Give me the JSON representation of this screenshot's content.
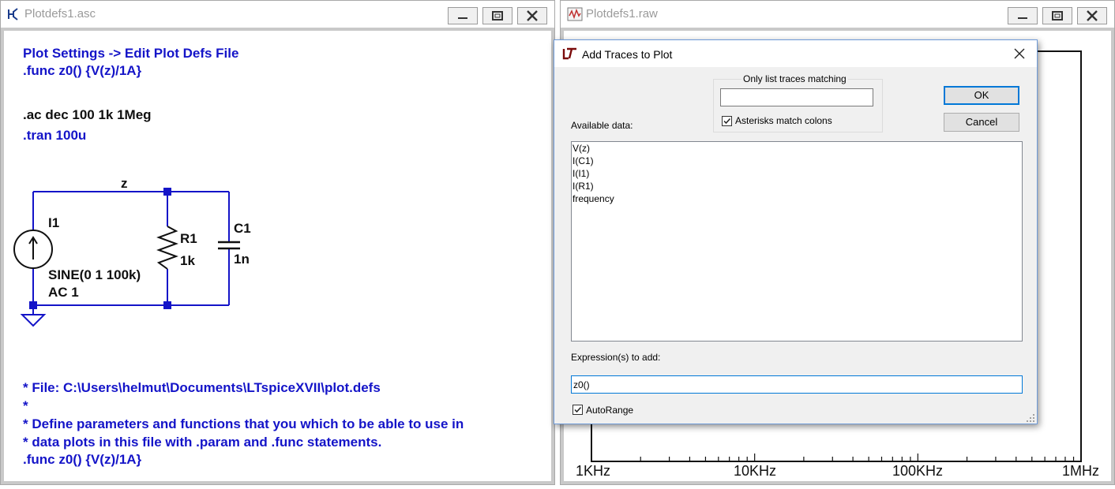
{
  "schematic_window": {
    "title": "Plotdefs1.asc",
    "directives": {
      "line1": "Plot Settings -> Edit Plot Defs File",
      "line2": ".func z0() {V(z)/1A}",
      "ac": ".ac dec 100 1k 1Meg",
      "tran": ".tran 100u"
    },
    "circuit": {
      "net_label": "z",
      "source_name": "I1",
      "source_value1": "SINE(0 1 100k)",
      "source_value2": "AC 1",
      "resistor_name": "R1",
      "resistor_value": "1k",
      "capacitor_name": "C1",
      "capacitor_value": "1n"
    },
    "comment_lines": [
      "* File: C:\\Users\\helmut\\Documents\\LTspiceXVII\\plot.defs",
      "*",
      "* Define parameters and functions that you which to be able to use in",
      "* data plots in this file with .param and .func statements.",
      ".func z0() {V(z)/1A}"
    ]
  },
  "waveform_window": {
    "title": "Plotdefs1.raw",
    "x_ticks": [
      "1KHz",
      "10KHz",
      "100KHz",
      "1MHz"
    ]
  },
  "dialog": {
    "title": "Add Traces to Plot",
    "filter_label": "Only list traces matching",
    "filter_value": "",
    "asterisks_label": "Asterisks match colons",
    "asterisks_checked": true,
    "ok_label": "OK",
    "cancel_label": "Cancel",
    "available_label": "Available data:",
    "available_items": [
      "V(z)",
      "I(C1)",
      "I(I1)",
      "I(R1)",
      "frequency"
    ],
    "expression_label": "Expression(s) to add:",
    "expression_value": "z0()",
    "autorange_label": "AutoRange",
    "autorange_checked": true
  },
  "colors": {
    "wire": "#1414c8",
    "directive": "#1414c8",
    "accent": "#0078d7"
  }
}
